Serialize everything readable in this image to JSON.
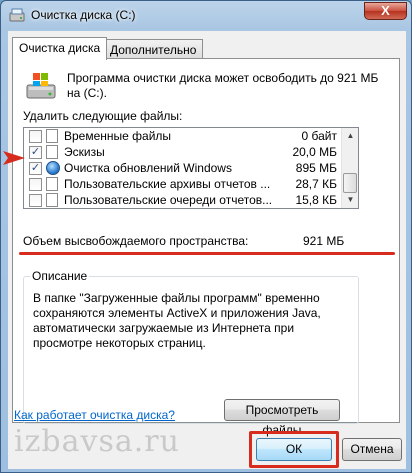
{
  "window": {
    "title": "Очистка диска  (C:)"
  },
  "tabs": [
    {
      "label": "Очистка диска",
      "active": true
    },
    {
      "label": "Дополнительно",
      "active": false
    }
  ],
  "summary": "Программа очистки диска может освободить до 921 МБ на  (C:).",
  "files_label": "Удалить следующие файлы:",
  "files": [
    {
      "name": "Временные файлы",
      "size": "0 байт",
      "checked": false
    },
    {
      "name": "Эскизы",
      "size": "20,0 МБ",
      "checked": true
    },
    {
      "name": "Очистка обновлений Windows",
      "size": "895 МБ",
      "checked": true
    },
    {
      "name": "Пользовательские архивы отчетов ...",
      "size": "28,7 КБ",
      "checked": false
    },
    {
      "name": "Пользовательские очереди отчетов...",
      "size": "15,8 КБ",
      "checked": false
    }
  ],
  "total": {
    "label": "Объем высвобождаемого пространства:",
    "value": "921 МБ"
  },
  "description": {
    "caption": "Описание",
    "text": "В папке \"Загруженные файлы программ\" временно сохраняются элементы ActiveX и приложения Java, автоматически загружаемые из Интернета при просмотре некоторых страниц."
  },
  "view_files_label": "Просмотреть файлы",
  "help_link": "Как работает очистка диска?",
  "watermark": "izbavsa.ru",
  "ok_label": "ОК",
  "cancel_label": "Отмена",
  "close_label": "X",
  "colors": {
    "annotation_red": "#d62b1d",
    "link_blue": "#0066cc"
  }
}
